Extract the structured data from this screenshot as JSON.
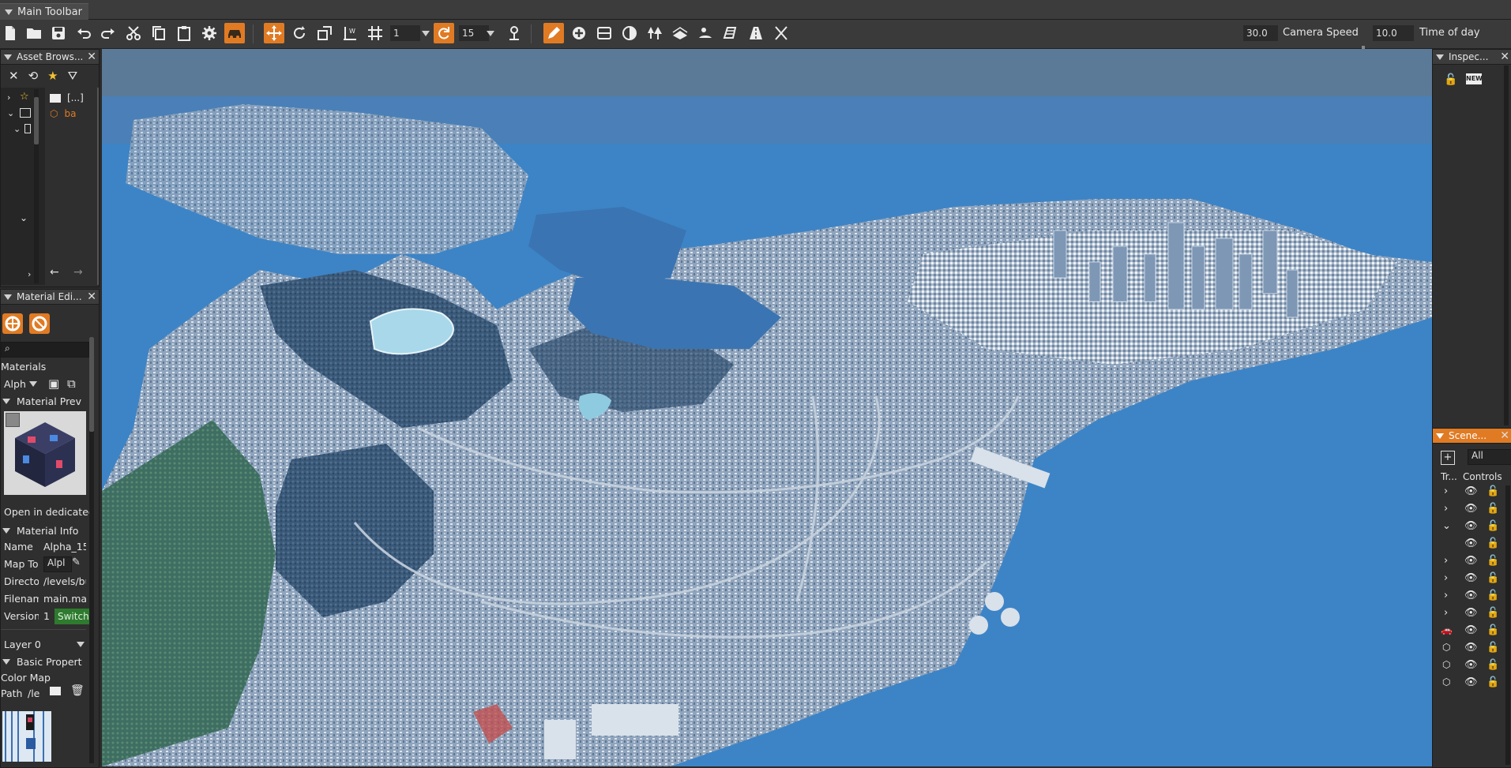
{
  "tab": {
    "title": "Main Toolbar"
  },
  "toolbar": {
    "number_a": "1",
    "number_b": "15",
    "camera_speed_value": "30.0",
    "camera_speed_label": "Camera Speed",
    "time_value": "10.0",
    "time_label": "Time of day",
    "icons": [
      "new-file-icon",
      "open-folder-icon",
      "save-icon",
      "undo-icon",
      "redo-icon",
      "cut-icon",
      "copy-icon",
      "paste-icon",
      "settings-gear-icon",
      "vehicle-icon",
      "move-icon",
      "rotate-icon",
      "scale-icon",
      "axis-icon",
      "grid-icon",
      "rotate-snap-icon",
      "pin-icon",
      "pencil-icon",
      "add-circle-icon",
      "road-icon",
      "decal-icon",
      "forest-icon",
      "terrain-paint-icon",
      "river-icon",
      "mesh-road-icon",
      "sidewalk-icon",
      "compass-icon"
    ],
    "accent": "#e07b24"
  },
  "asset_browser": {
    "title": "Asset Brows...",
    "tree_items": [
      "[...]",
      "ba"
    ]
  },
  "material_editor": {
    "title": "Material Edi...",
    "section_materials": "Materials",
    "material_select": "Alph",
    "preview_header": "Material Prev",
    "open_dedicated": "Open in dedicated",
    "info_header": "Material Info",
    "name_label": "Name",
    "name_value": "Alpha_15",
    "mapto_label": "Map To",
    "mapto_value": "Alpl",
    "directory_label": "Director",
    "directory_value": "/levels/bu",
    "filename_label": "Filenam",
    "filename_value": "main.mat",
    "version_label": "Version",
    "version_value": "1",
    "switch_label": "Switch",
    "layer_select": "Layer 0",
    "basic_header": "Basic Propert",
    "colormap_label": "Color Map",
    "path_label": "Path",
    "path_value": "/le"
  },
  "inspector": {
    "title": "Inspec...",
    "new_badge": "NEW"
  },
  "scene_tree": {
    "title": "Scene...",
    "filter_value": "All",
    "col_tree": "Tr...",
    "col_controls": "Controls",
    "rows": [
      {
        "kind": "collapsed"
      },
      {
        "kind": "collapsed"
      },
      {
        "kind": "expanded"
      },
      {
        "kind": "child"
      },
      {
        "kind": "collapsed"
      },
      {
        "kind": "collapsed"
      },
      {
        "kind": "collapsed"
      },
      {
        "kind": "collapsed"
      },
      {
        "kind": "vehicle"
      },
      {
        "kind": "object"
      },
      {
        "kind": "object"
      },
      {
        "kind": "object"
      }
    ]
  }
}
